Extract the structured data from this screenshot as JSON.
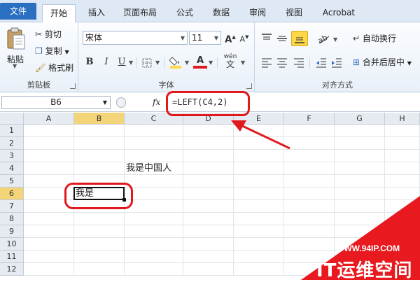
{
  "tabs": [
    {
      "label": "文件"
    },
    {
      "label": "开始"
    },
    {
      "label": "插入"
    },
    {
      "label": "页面布局"
    },
    {
      "label": "公式"
    },
    {
      "label": "数据"
    },
    {
      "label": "审阅"
    },
    {
      "label": "视图"
    },
    {
      "label": "Acrobat"
    }
  ],
  "clipboard": {
    "paste": "粘贴",
    "cut": "剪切",
    "copy": "复制",
    "format_painter": "格式刷",
    "label": "剪贴板"
  },
  "font": {
    "name": "宋体",
    "size": "11",
    "grow": "A",
    "shrink": "A",
    "bold": "B",
    "italic": "I",
    "underline": "U",
    "color_letter": "A",
    "wen": "wén",
    "wen_char": "文",
    "label": "字体"
  },
  "alignment": {
    "wrap_text": "自动换行",
    "merge_center": "合并后居中",
    "label": "对齐方式"
  },
  "formula_bar": {
    "name_box": "B6",
    "fx": "fx",
    "formula": "=LEFT(C4,2)"
  },
  "columns": [
    "A",
    "B",
    "C",
    "D",
    "E",
    "F",
    "G",
    "H"
  ],
  "rows": [
    "1",
    "2",
    "3",
    "4",
    "5",
    "6",
    "7",
    "8",
    "9",
    "10",
    "11",
    "12"
  ],
  "cells": {
    "C4": "我是中国人",
    "B6": "我是"
  },
  "selected": {
    "column": "B",
    "row": "6"
  },
  "watermark": {
    "url": "WWW.94IP.COM",
    "text": "IT运维空间"
  },
  "colors": {
    "file_tab": "#2a6fc0",
    "annotation": "#e0191f",
    "selection_header": "#f4d478",
    "highlight_yellow": "#ffd84a"
  }
}
